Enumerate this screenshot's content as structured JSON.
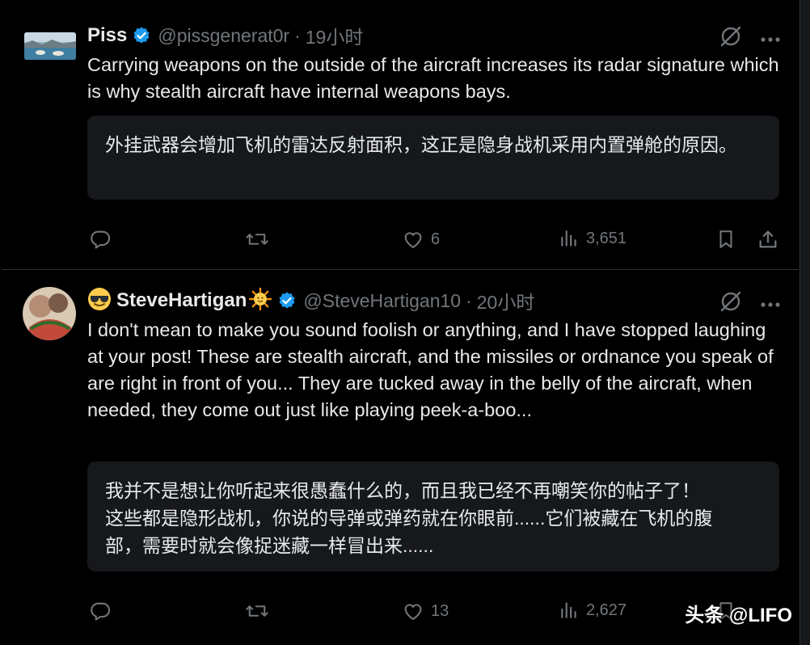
{
  "tweets": [
    {
      "author": {
        "name": "Piss",
        "handle": "@pissgenerat0r",
        "verified": true,
        "avatar": "landscape-avatar"
      },
      "time": "19小时",
      "dot": "·",
      "text": "Carrying weapons on the outside of the aircraft increases its radar signature which is why stealth aircraft have internal weapons bays.",
      "translation": [
        "外挂武器会增加飞机的雷达反射面积，这正是隐身战机采用内置弹舱的原因。"
      ],
      "actions": {
        "replies": "",
        "reposts": "",
        "likes": "6",
        "views": "3,651"
      }
    },
    {
      "author": {
        "name": "SteveHartigan",
        "handle": "@SteveHartigan10",
        "verified": true,
        "avatar": "photo-avatar",
        "name_prefix_emoji": "sunglasses-emoji",
        "name_suffix_emoji": "sun-emoji"
      },
      "time": "20小时",
      "dot": "·",
      "text": "I don't mean to make you sound foolish or anything, and I have stopped laughing at your post! These are stealth aircraft, and the missiles or ordnance you speak of are right in front of you... They are tucked away in the belly of the aircraft, when needed, they come out just like playing peek-a-boo...",
      "translation": [
        "我并不是想让你听起来很愚蠢什么的，而且我已经不再嘲笑你的帖子了！",
        "这些都是隐形战机，你说的导弹或弹药就在你眼前......它们被藏在飞机的腹",
        "部，需要时就会像捉迷藏一样冒出来......"
      ],
      "actions": {
        "replies": "",
        "reposts": "",
        "likes": "13",
        "views": "2,627"
      }
    }
  ],
  "watermark": "头条 @LIFO",
  "colors": {
    "background": "#000000",
    "text": "#e7e9ea",
    "muted": "#71767b",
    "verified": "#1d9bf0",
    "translate_bg": "#16181c",
    "divider": "#2f3336"
  },
  "icons": [
    "verified-badge-icon",
    "grok-icon",
    "more-icon",
    "reply-icon",
    "repost-icon",
    "like-icon",
    "views-icon",
    "bookmark-icon",
    "share-icon"
  ]
}
